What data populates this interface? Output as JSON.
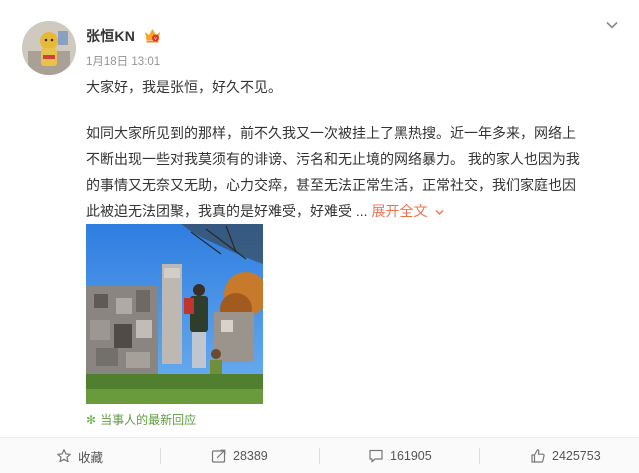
{
  "post": {
    "author": "张恒KN",
    "timestamp": "1月18日 13:01",
    "greeting": "大家好，我是张恒，好久不见。",
    "paragraph_lines": [
      "如同大家所见到的那样，前不久我又一次被挂上了黑热搜。近一年多来，网络上",
      "不断出现一些对我莫须有的诽谤、污名和无止境的网络暴力。 我的家人也因为我",
      "的事情又无奈又无助，心力交瘁，甚至无法正常生活，正常社交，我们家庭也因",
      "此被迫无法团聚，我真的是好难受，好难受 ... "
    ],
    "expand_label": "展开全文",
    "reply_link": "当事人的最新回应"
  },
  "actions": {
    "favorite_label": "收藏",
    "repost_count": "28389",
    "comment_count": "161905",
    "like_count": "2425753"
  },
  "colors": {
    "accent_orange": "#eb7350",
    "reply_green": "#5d9c3f",
    "meta_gray": "#939393"
  }
}
